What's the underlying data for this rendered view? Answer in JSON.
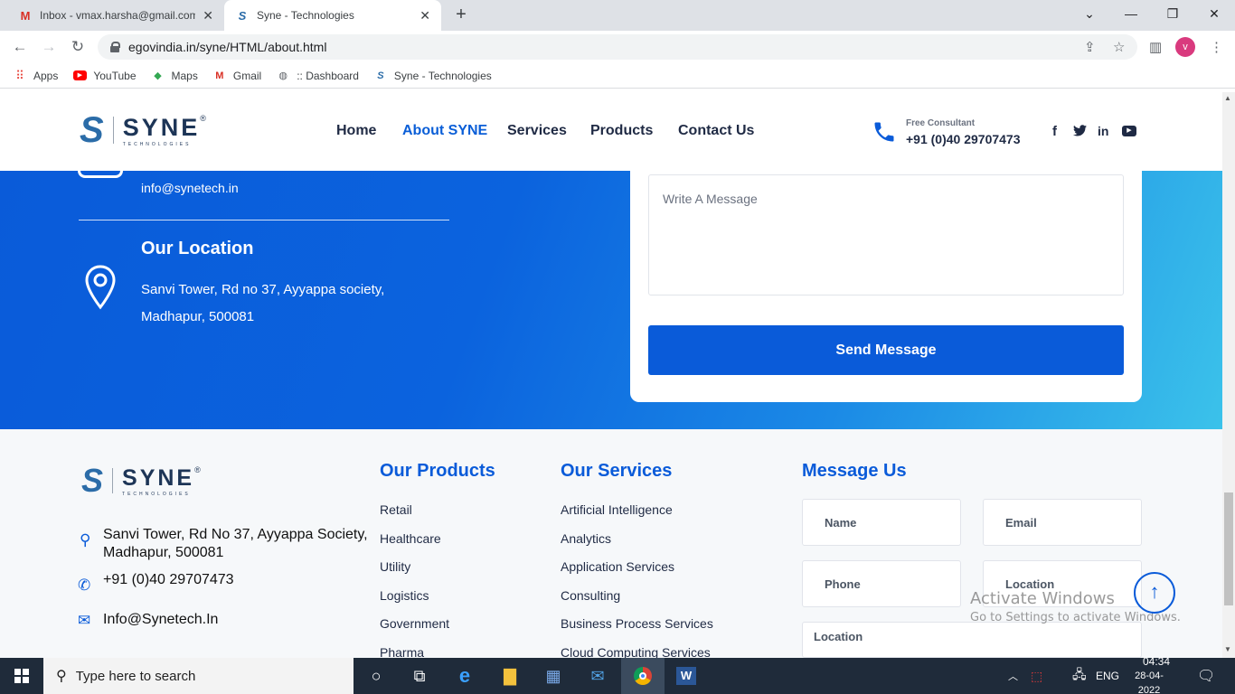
{
  "browser": {
    "tabs": [
      {
        "title": "Inbox - vmax.harsha@gmail.com",
        "icon": "gmail-icon"
      },
      {
        "title": "Syne - Technologies",
        "icon": "syne-icon"
      }
    ],
    "url": "egovindia.in/syne/HTML/about.html",
    "avatar_letter": "v",
    "bookmarks": [
      {
        "label": "Apps",
        "icon": "apps-grid-icon"
      },
      {
        "label": "YouTube",
        "icon": "youtube-icon"
      },
      {
        "label": "Maps",
        "icon": "maps-icon"
      },
      {
        "label": "Gmail",
        "icon": "gmail-icon"
      },
      {
        "label": ":: Dashboard",
        "icon": "globe-icon"
      },
      {
        "label": "Syne - Technologies",
        "icon": "syne-icon"
      }
    ]
  },
  "site": {
    "logo": {
      "mark": "S",
      "name": "SYNE",
      "reg": "®",
      "sub": "TECHNOLOGIES"
    },
    "nav": [
      "Home",
      "About SYNE",
      "Services",
      "Products",
      "Contact Us"
    ],
    "active_nav": "About SYNE",
    "consult": {
      "label": "Free Consultant",
      "phone": "+91 (0)40 29707473"
    },
    "social": [
      "facebook-icon",
      "twitter-icon",
      "linkedin-icon",
      "youtube-icon"
    ]
  },
  "contact": {
    "email": "info@synetech.in",
    "location_title": "Our Location",
    "address_line1": "Sanvi Tower, Rd no 37, Ayyappa society,",
    "address_line2": "Madhapur, 500081",
    "message_placeholder": "Write A Message",
    "send_label": "Send Message"
  },
  "footer": {
    "address_line1": "Sanvi Tower, Rd No 37, Ayyappa Society,",
    "address_line2": "Madhapur, 500081",
    "phone": "+91 (0)40 29707473",
    "email": "Info@Synetech.In",
    "products_title": "Our Products",
    "products": [
      "Retail",
      "Healthcare",
      "Utility",
      "Logistics",
      "Government",
      "Pharma"
    ],
    "services_title": "Our Services",
    "services": [
      "Artificial Intelligence",
      "Analytics",
      "Application Services",
      "Consulting",
      "Business Process Services",
      "Cloud Computing Services"
    ],
    "message_title": "Message Us",
    "fields": {
      "name": "Name",
      "email": "Email",
      "phone": "Phone",
      "location": "Location",
      "location2": "Location"
    }
  },
  "watermark": {
    "line1": "Activate Windows",
    "line2": "Go to Settings to activate Windows."
  },
  "taskbar": {
    "search_placeholder": "Type here to search",
    "lang": "ENG",
    "time": "04:34",
    "date": "28-04-2022"
  }
}
